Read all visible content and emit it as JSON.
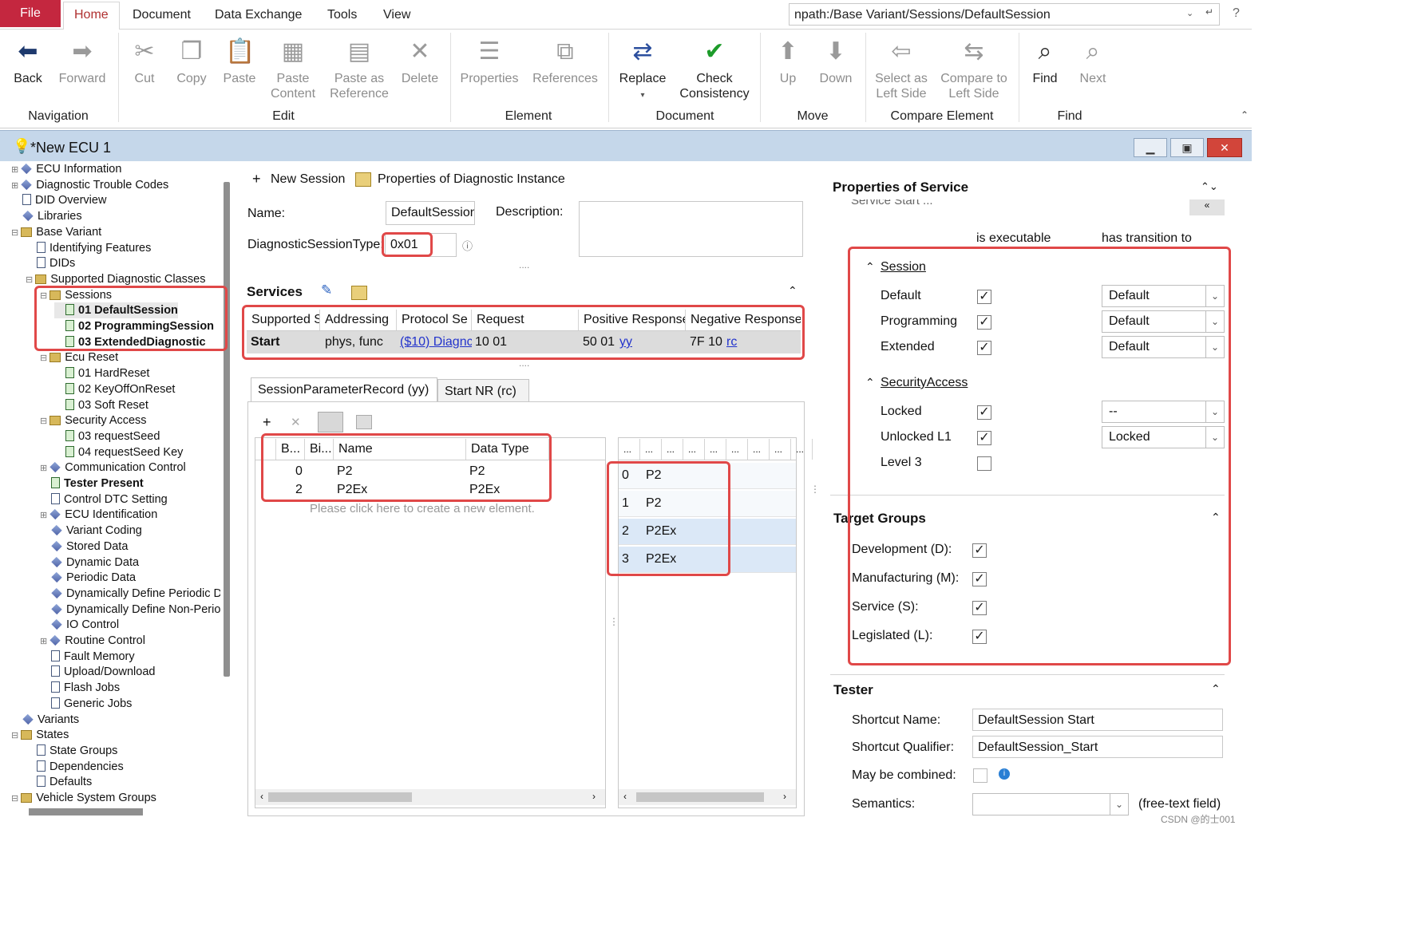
{
  "ribbon": {
    "tabs": {
      "file": "File",
      "home": "Home",
      "document": "Document",
      "data_exchange": "Data Exchange",
      "tools": "Tools",
      "view": "View"
    },
    "path": "npath:/Base Variant/Sessions/DefaultSession",
    "buttons": {
      "back": "Back",
      "forward": "Forward",
      "cut": "Cut",
      "copy": "Copy",
      "paste": "Paste",
      "paste_content_1": "Paste",
      "paste_content_2": "Content",
      "paste_ref_1": "Paste as",
      "paste_ref_2": "Reference",
      "delete": "Delete",
      "properties": "Properties",
      "references": "References",
      "replace": "Replace",
      "check_1": "Check",
      "check_2": "Consistency",
      "up": "Up",
      "down": "Down",
      "select_left_1": "Select as",
      "select_left_2": "Left Side",
      "compare_left_1": "Compare to",
      "compare_left_2": "Left Side",
      "find": "Find",
      "next": "Next"
    },
    "groups": {
      "navigation": "Navigation",
      "edit": "Edit",
      "element": "Element",
      "document": "Document",
      "move": "Move",
      "compare": "Compare Element",
      "find": "Find"
    }
  },
  "window": {
    "title": "*New ECU 1"
  },
  "tree": [
    {
      "label": "ECU Information",
      "bold": false
    },
    {
      "label": "Diagnostic Trouble Codes",
      "bold": false
    },
    {
      "label": "DID Overview",
      "bold": false
    },
    {
      "label": "Libraries",
      "bold": false
    },
    {
      "label": "Base Variant",
      "bold": false
    },
    {
      "label": "Identifying Features",
      "bold": false
    },
    {
      "label": "DIDs",
      "bold": false
    },
    {
      "label": "Supported Diagnostic Classes",
      "bold": false
    },
    {
      "label": "Sessions",
      "bold": false
    },
    {
      "label": "01 DefaultSession",
      "bold": true
    },
    {
      "label": "02 ProgrammingSession",
      "bold": true
    },
    {
      "label": "03 ExtendedDiagnostic",
      "bold": true
    },
    {
      "label": "Ecu Reset",
      "bold": false
    },
    {
      "label": "01  HardReset",
      "bold": false
    },
    {
      "label": "02  KeyOffOnReset",
      "bold": false
    },
    {
      "label": "03 Soft Reset",
      "bold": false
    },
    {
      "label": "Security Access",
      "bold": false
    },
    {
      "label": "03 requestSeed",
      "bold": false
    },
    {
      "label": "04 requestSeed Key",
      "bold": false
    },
    {
      "label": "Communication Control",
      "bold": false
    },
    {
      "label": "Tester Present",
      "bold": true
    },
    {
      "label": "Control DTC Setting",
      "bold": false
    },
    {
      "label": "ECU Identification",
      "bold": false
    },
    {
      "label": "Variant Coding",
      "bold": false
    },
    {
      "label": "Stored Data",
      "bold": false
    },
    {
      "label": "Dynamic Data",
      "bold": false
    },
    {
      "label": "Periodic Data",
      "bold": false
    },
    {
      "label": "Dynamically Define Periodic D",
      "bold": false
    },
    {
      "label": "Dynamically Define Non-Perio",
      "bold": false
    },
    {
      "label": "IO Control",
      "bold": false
    },
    {
      "label": "Routine Control",
      "bold": false
    },
    {
      "label": "Fault Memory",
      "bold": false
    },
    {
      "label": "Upload/Download",
      "bold": false
    },
    {
      "label": "Flash Jobs",
      "bold": false
    },
    {
      "label": "Generic Jobs",
      "bold": false
    },
    {
      "label": "Variants",
      "bold": false
    },
    {
      "label": "States",
      "bold": false
    },
    {
      "label": "State Groups",
      "bold": false
    },
    {
      "label": "Dependencies",
      "bold": false
    },
    {
      "label": "Defaults",
      "bold": false
    },
    {
      "label": "Vehicle System Groups",
      "bold": false
    }
  ],
  "middle": {
    "new_session": "New Session",
    "properties_instance": "Properties of Diagnostic Instance",
    "name_label": "Name:",
    "name_value": "DefaultSession",
    "description_label": "Description:",
    "session_type_label": "DiagnosticSessionType:",
    "session_type_value": "0x01",
    "services_title": "Services",
    "services_headers": [
      "Supported S",
      "Addressing",
      "Protocol Se",
      "Request",
      "Positive Response",
      "Negative Response"
    ],
    "services_row": {
      "supported": "Start",
      "addressing": "phys, func",
      "protocol": "($10) Diagnc",
      "request": "10 01",
      "positive_prefix": "50 01",
      "positive_link": "yy",
      "negative_prefix": "7F 10",
      "negative_link": "rc"
    },
    "tabs": [
      "SessionParameterRecord (yy)",
      "Start NR (rc)"
    ],
    "param_headers": [
      "B...",
      "Bi...",
      "Name",
      "Data Type"
    ],
    "param_rows": [
      {
        "b": "0",
        "name": "P2",
        "type": "P2"
      },
      {
        "b": "2",
        "name": "P2Ex",
        "type": "P2Ex"
      }
    ],
    "create_hint": "Please click here to create a new element.",
    "right_headers": [
      "...",
      "...",
      "...",
      "...",
      "...",
      "...",
      "...",
      "...",
      "..."
    ],
    "right_rows": [
      {
        "idx": "0",
        "name": "P2"
      },
      {
        "idx": "1",
        "name": "P2"
      },
      {
        "idx": "2",
        "name": "P2Ex"
      },
      {
        "idx": "3",
        "name": "P2Ex"
      }
    ]
  },
  "props": {
    "title": "Properties of Service",
    "cut_text": "Service Start ...",
    "col_exec": "is executable",
    "col_trans": "has transition to",
    "session_group": "Session",
    "sessions": [
      {
        "label": "Default",
        "checked": true,
        "trans": "Default"
      },
      {
        "label": "Programming",
        "checked": true,
        "trans": "Default"
      },
      {
        "label": "Extended",
        "checked": true,
        "trans": "Default"
      }
    ],
    "security_group": "SecurityAccess",
    "security": [
      {
        "label": "Locked",
        "checked": true,
        "trans": "--"
      },
      {
        "label": "Unlocked L1",
        "checked": true,
        "trans": "Locked"
      },
      {
        "label": "Level 3",
        "checked": false,
        "trans": ""
      }
    ],
    "target_title": "Target Groups",
    "targets": [
      {
        "label": "Development (D):",
        "checked": true
      },
      {
        "label": "Manufacturing (M):",
        "checked": true
      },
      {
        "label": "Service (S):",
        "checked": true
      },
      {
        "label": "Legislated (L):",
        "checked": true
      }
    ],
    "tester_title": "Tester",
    "shortcut_name_label": "Shortcut Name:",
    "shortcut_name": "DefaultSession Start",
    "shortcut_qual_label": "Shortcut Qualifier:",
    "shortcut_qual": "DefaultSession_Start",
    "combined_label": "May be combined:",
    "semantics_label": "Semantics:",
    "semantics_hint": "(free-text field)",
    "watermark": "CSDN @的士001"
  }
}
